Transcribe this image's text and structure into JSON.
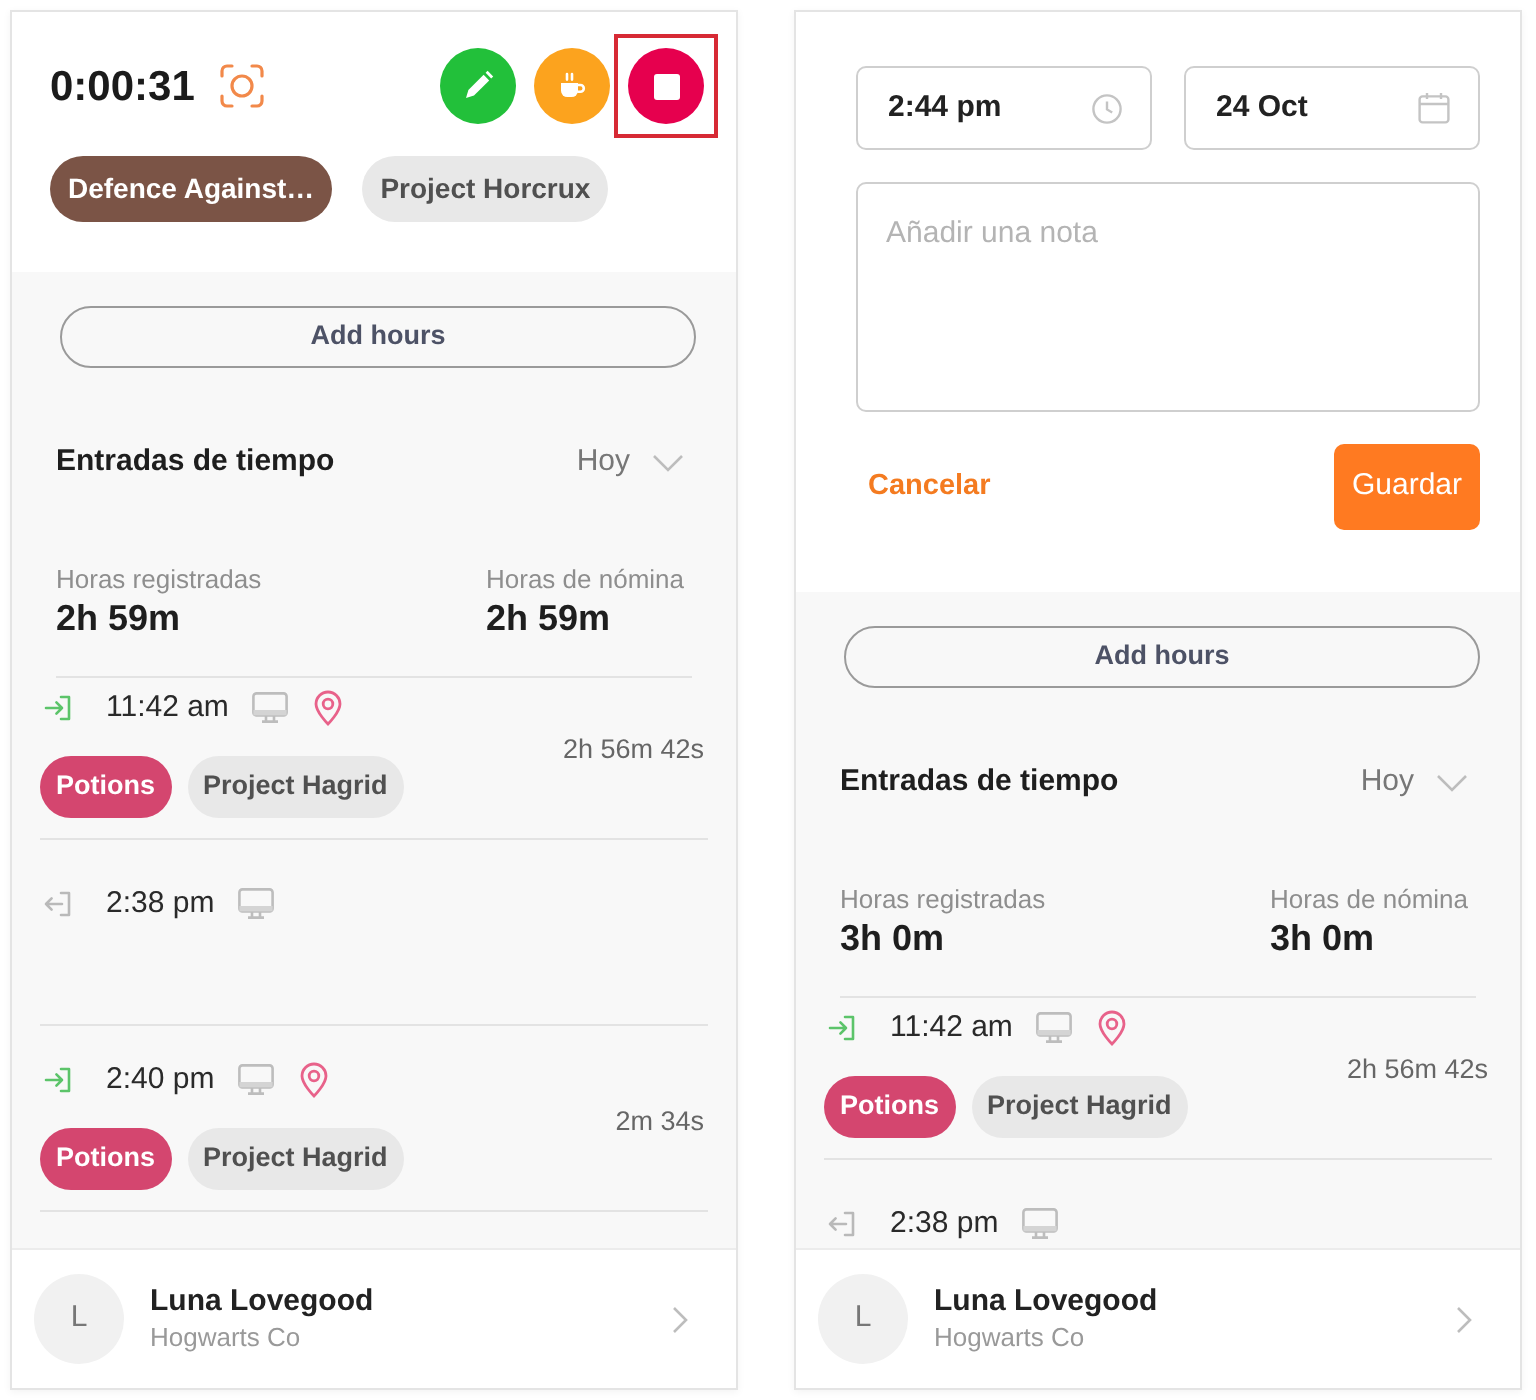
{
  "panels": [
    {
      "kind": "timer",
      "timer": {
        "elapsed": "0:00:31",
        "actions": [
          {
            "kind": "switch",
            "highlighted": false
          },
          {
            "kind": "break",
            "highlighted": false
          },
          {
            "kind": "stop",
            "highlighted": true
          }
        ],
        "tags": [
          {
            "label": "Defence Against…",
            "color": "#7b5446"
          },
          {
            "label": "Project Horcrux",
            "color": "#e8e8e8"
          }
        ]
      },
      "add_button": "Add hours",
      "entries_header": {
        "title": "Entradas de tiempo",
        "period": "Hoy"
      },
      "totals": [
        {
          "label": "Horas registradas",
          "value": "2h 59m"
        },
        {
          "label": "Horas de nómina",
          "value": "2h 59m"
        }
      ],
      "entries": [
        {
          "kind": "in",
          "time": "11:42 am",
          "location": true,
          "duration": "2h 56m 42s",
          "tags": [
            {
              "label": "Potions",
              "color": "#d4466f"
            },
            {
              "label": "Project Hagrid",
              "color": "#e8e8e8"
            }
          ]
        },
        {
          "kind": "out",
          "time": "2:38 pm",
          "location": false
        },
        {
          "kind": "in",
          "time": "2:40 pm",
          "location": true,
          "duration": "2m 34s",
          "tags": [
            {
              "label": "Potions",
              "color": "#d4466f"
            },
            {
              "label": "Project Hagrid",
              "color": "#e8e8e8"
            }
          ]
        }
      ],
      "user": {
        "initial": "L",
        "name": "Luna Lovegood",
        "company": "Hogwarts Co"
      }
    },
    {
      "kind": "edit",
      "form": {
        "time": {
          "value": "2:44 pm"
        },
        "date": {
          "value": "24 Oct"
        },
        "note": {
          "placeholder": "Añadir una nota"
        },
        "cancel": "Cancelar",
        "save": "Guardar"
      },
      "add_button": "Add hours",
      "entries_header": {
        "title": "Entradas de tiempo",
        "period": "Hoy"
      },
      "totals": [
        {
          "label": "Horas registradas",
          "value": "3h 0m"
        },
        {
          "label": "Horas de nómina",
          "value": "3h 0m"
        }
      ],
      "entries": [
        {
          "kind": "in",
          "time": "11:42 am",
          "location": true,
          "duration": "2h 56m 42s",
          "tags": [
            {
              "label": "Potions",
              "color": "#d4466f"
            },
            {
              "label": "Project Hagrid",
              "color": "#e8e8e8"
            }
          ]
        },
        {
          "kind": "out",
          "time": "2:38 pm",
          "location": false
        }
      ],
      "user": {
        "initial": "L",
        "name": "Luna Lovegood",
        "company": "Hogwarts Co"
      }
    }
  ]
}
